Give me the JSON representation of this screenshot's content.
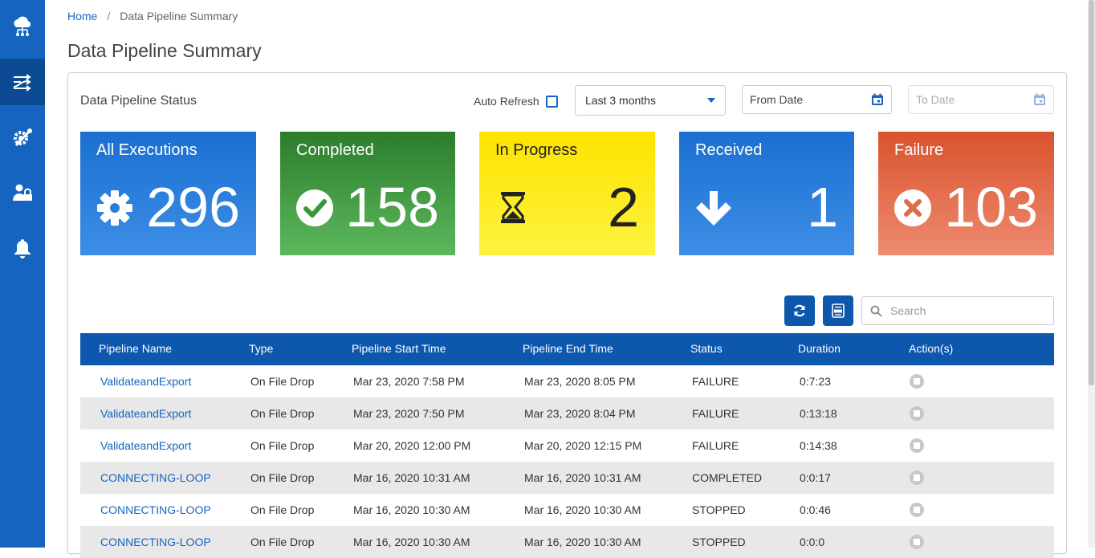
{
  "sidebar": {
    "items": [
      {
        "icon": "cloud-network-icon",
        "active": false
      },
      {
        "icon": "pipeline-shuffle-icon",
        "active": true
      },
      {
        "icon": "tools-gear-icon",
        "active": false
      },
      {
        "icon": "user-lock-icon",
        "active": false
      },
      {
        "icon": "bell-icon",
        "active": false
      }
    ]
  },
  "breadcrumb": {
    "home": "Home",
    "separator": "/",
    "current": "Data Pipeline Summary"
  },
  "page_title": "Data Pipeline Summary",
  "status_panel": {
    "title": "Data Pipeline Status",
    "auto_refresh_label": "Auto Refresh",
    "auto_refresh_checked": false,
    "range_select": "Last 3 months",
    "from_date_placeholder": "From Date",
    "to_date_placeholder": "To Date"
  },
  "tiles": {
    "all": {
      "label": "All Executions",
      "value": "296",
      "icon": "gear-icon",
      "color": "#1a6fd0"
    },
    "completed": {
      "label": "Completed",
      "value": "158",
      "icon": "check-circle-icon",
      "color": "#2c7d2c"
    },
    "progress": {
      "label": "In Progress",
      "value": "2",
      "icon": "hourglass-icon",
      "color": "#fde300"
    },
    "received": {
      "label": "Received",
      "value": "1",
      "icon": "arrow-down-icon",
      "color": "#1a6fd0"
    },
    "failure": {
      "label": "Failure",
      "value": "103",
      "icon": "x-circle-icon",
      "color": "#d9532e"
    }
  },
  "toolbar": {
    "search_placeholder": "Search"
  },
  "table": {
    "headers": {
      "name": "Pipeline Name",
      "type": "Type",
      "start": "Pipeline Start Time",
      "end": "Pipeline End Time",
      "status": "Status",
      "duration": "Duration",
      "actions": "Action(s)"
    },
    "rows": [
      {
        "name": "ValidateandExport",
        "type": "On File Drop",
        "start": "Mar 23, 2020 7:58 PM",
        "end": "Mar 23, 2020 8:05 PM",
        "status": "FAILURE",
        "duration": "0:7:23"
      },
      {
        "name": "ValidateandExport",
        "type": "On File Drop",
        "start": "Mar 23, 2020 7:50 PM",
        "end": "Mar 23, 2020 8:04 PM",
        "status": "FAILURE",
        "duration": "0:13:18"
      },
      {
        "name": "ValidateandExport",
        "type": "On File Drop",
        "start": "Mar 20, 2020 12:00 PM",
        "end": "Mar 20, 2020 12:15 PM",
        "status": "FAILURE",
        "duration": "0:14:38"
      },
      {
        "name": "CONNECTING-LOOP",
        "type": "On File Drop",
        "start": "Mar 16, 2020 10:31 AM",
        "end": "Mar 16, 2020 10:31 AM",
        "status": "COMPLETED",
        "duration": "0:0:17"
      },
      {
        "name": "CONNECTING-LOOP",
        "type": "On File Drop",
        "start": "Mar 16, 2020 10:30 AM",
        "end": "Mar 16, 2020 10:30 AM",
        "status": "STOPPED",
        "duration": "0:0:46"
      },
      {
        "name": "CONNECTING-LOOP",
        "type": "On File Drop",
        "start": "Mar 16, 2020 10:30 AM",
        "end": "Mar 16, 2020 10:30 AM",
        "status": "STOPPED",
        "duration": "0:0:0"
      }
    ]
  }
}
